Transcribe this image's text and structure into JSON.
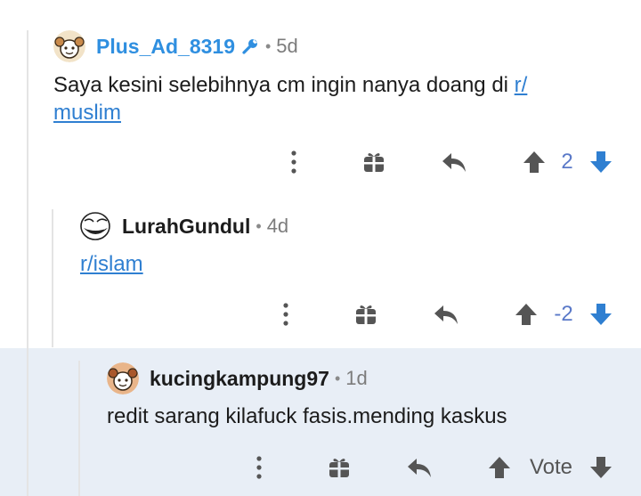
{
  "colors": {
    "link": "#2f7fd1",
    "vote": "#5a79c8",
    "highlight_bg": "#e8eef6",
    "thread_line": "#e4e4e4"
  },
  "comments": [
    {
      "author": "Plus_Ad_8319",
      "author_color": "#2f8fe0",
      "age": "5d",
      "dot": "•",
      "has_mod_icon": true,
      "text_before": "Saya kesini selebihnya cm ingin nanya doang di ",
      "link_line1": "r/",
      "link_line2": "muslim",
      "score": "2",
      "icons": [
        "more-icon",
        "gift-icon",
        "reply-icon",
        "upvote-icon",
        "downvote-icon"
      ]
    },
    {
      "author": "LurahGundul",
      "author_color": "#1c1c1c",
      "age": "4d",
      "dot": "•",
      "link": "r/islam",
      "score": "-2",
      "icons": [
        "more-icon",
        "gift-icon",
        "reply-icon",
        "upvote-icon",
        "downvote-icon"
      ]
    },
    {
      "author": "kucingkampung97",
      "author_color": "#1c1c1c",
      "age": "1d",
      "dot": "•",
      "text": "redit sarang kilafuck fasis.mending kaskus",
      "score": "Vote",
      "icons": [
        "more-icon",
        "gift-icon",
        "reply-icon",
        "upvote-icon",
        "downvote-icon"
      ]
    }
  ]
}
